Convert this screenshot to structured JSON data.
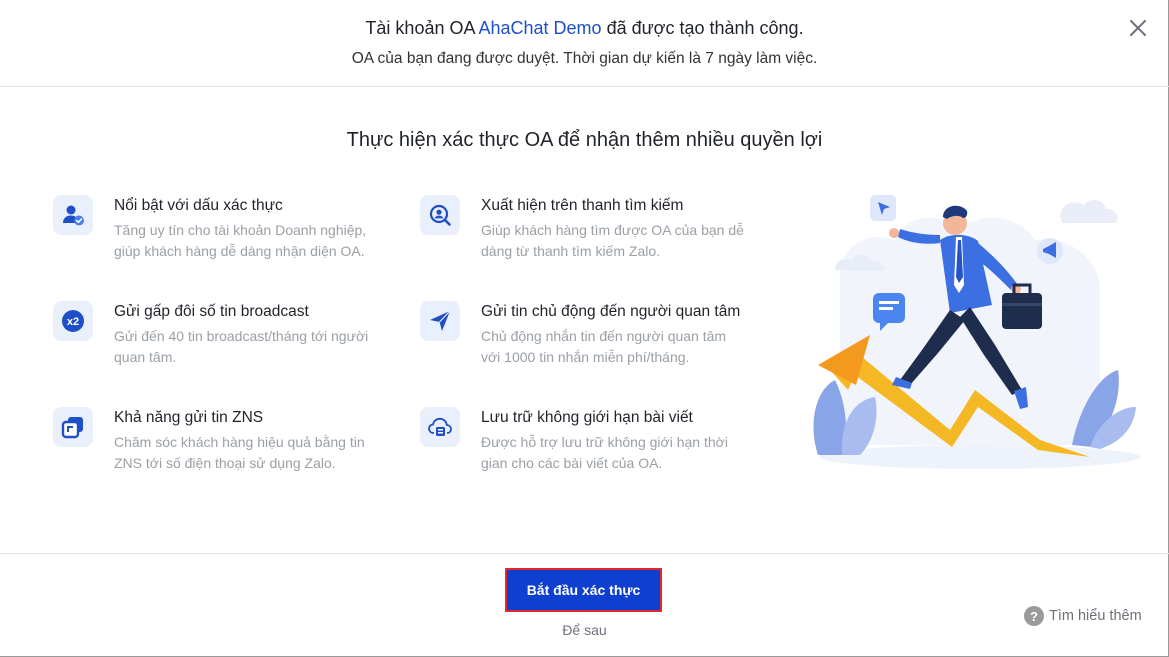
{
  "header": {
    "title_prefix": "Tài khoản OA ",
    "title_accent": "AhaChat Demo",
    "title_suffix": " đã được tạo thành công.",
    "subtitle": "OA của bạn đang được duyệt. Thời gian dự kiến là 7 ngày làm việc.",
    "close_icon": "close-icon"
  },
  "section_title": "Thực hiện xác thực OA để nhận thêm nhiều quyền lợi",
  "features": [
    {
      "icon": "verified-user-icon",
      "title": "Nổi bật với dấu xác thực",
      "desc": "Tăng uy tín cho tài khoản Doanh nghiệp, giúp khách hàng dễ dàng nhận diện OA."
    },
    {
      "icon": "search-user-icon",
      "title": "Xuất hiện trên thanh tìm kiếm",
      "desc": "Giúp khách hàng tìm được OA của bạn dễ dàng từ thanh tìm kiếm Zalo."
    },
    {
      "icon": "x2-icon",
      "title": "Gửi gấp đôi số tin broadcast",
      "desc": "Gửi đến 40 tin broadcast/tháng tới người quan tâm."
    },
    {
      "icon": "send-icon",
      "title": "Gửi tin chủ động đến người quan tâm",
      "desc": "Chủ động nhắn tin đến người quan tâm với 1000 tin nhắn miễn phí/tháng."
    },
    {
      "icon": "zns-icon",
      "title": "Khả năng gửi tin ZNS",
      "desc": "Chăm sóc khách hàng hiệu quả bằng tin ZNS tới số điện thoại sử dụng Zalo."
    },
    {
      "icon": "cloud-storage-icon",
      "title": "Lưu trữ không giới hạn bài viết",
      "desc": "Được hỗ trợ lưu trữ không giới hạn thời gian cho các bài viết của OA."
    }
  ],
  "footer": {
    "primary_button": "Bắt đầu xác thực",
    "later_link": "Để sau",
    "learn_more": "Tìm hiểu thêm"
  },
  "colors": {
    "accent": "#1f4fc7",
    "button": "#0f3fce",
    "button_border": "#e0282e",
    "icon_bg": "#eaf0fb"
  }
}
